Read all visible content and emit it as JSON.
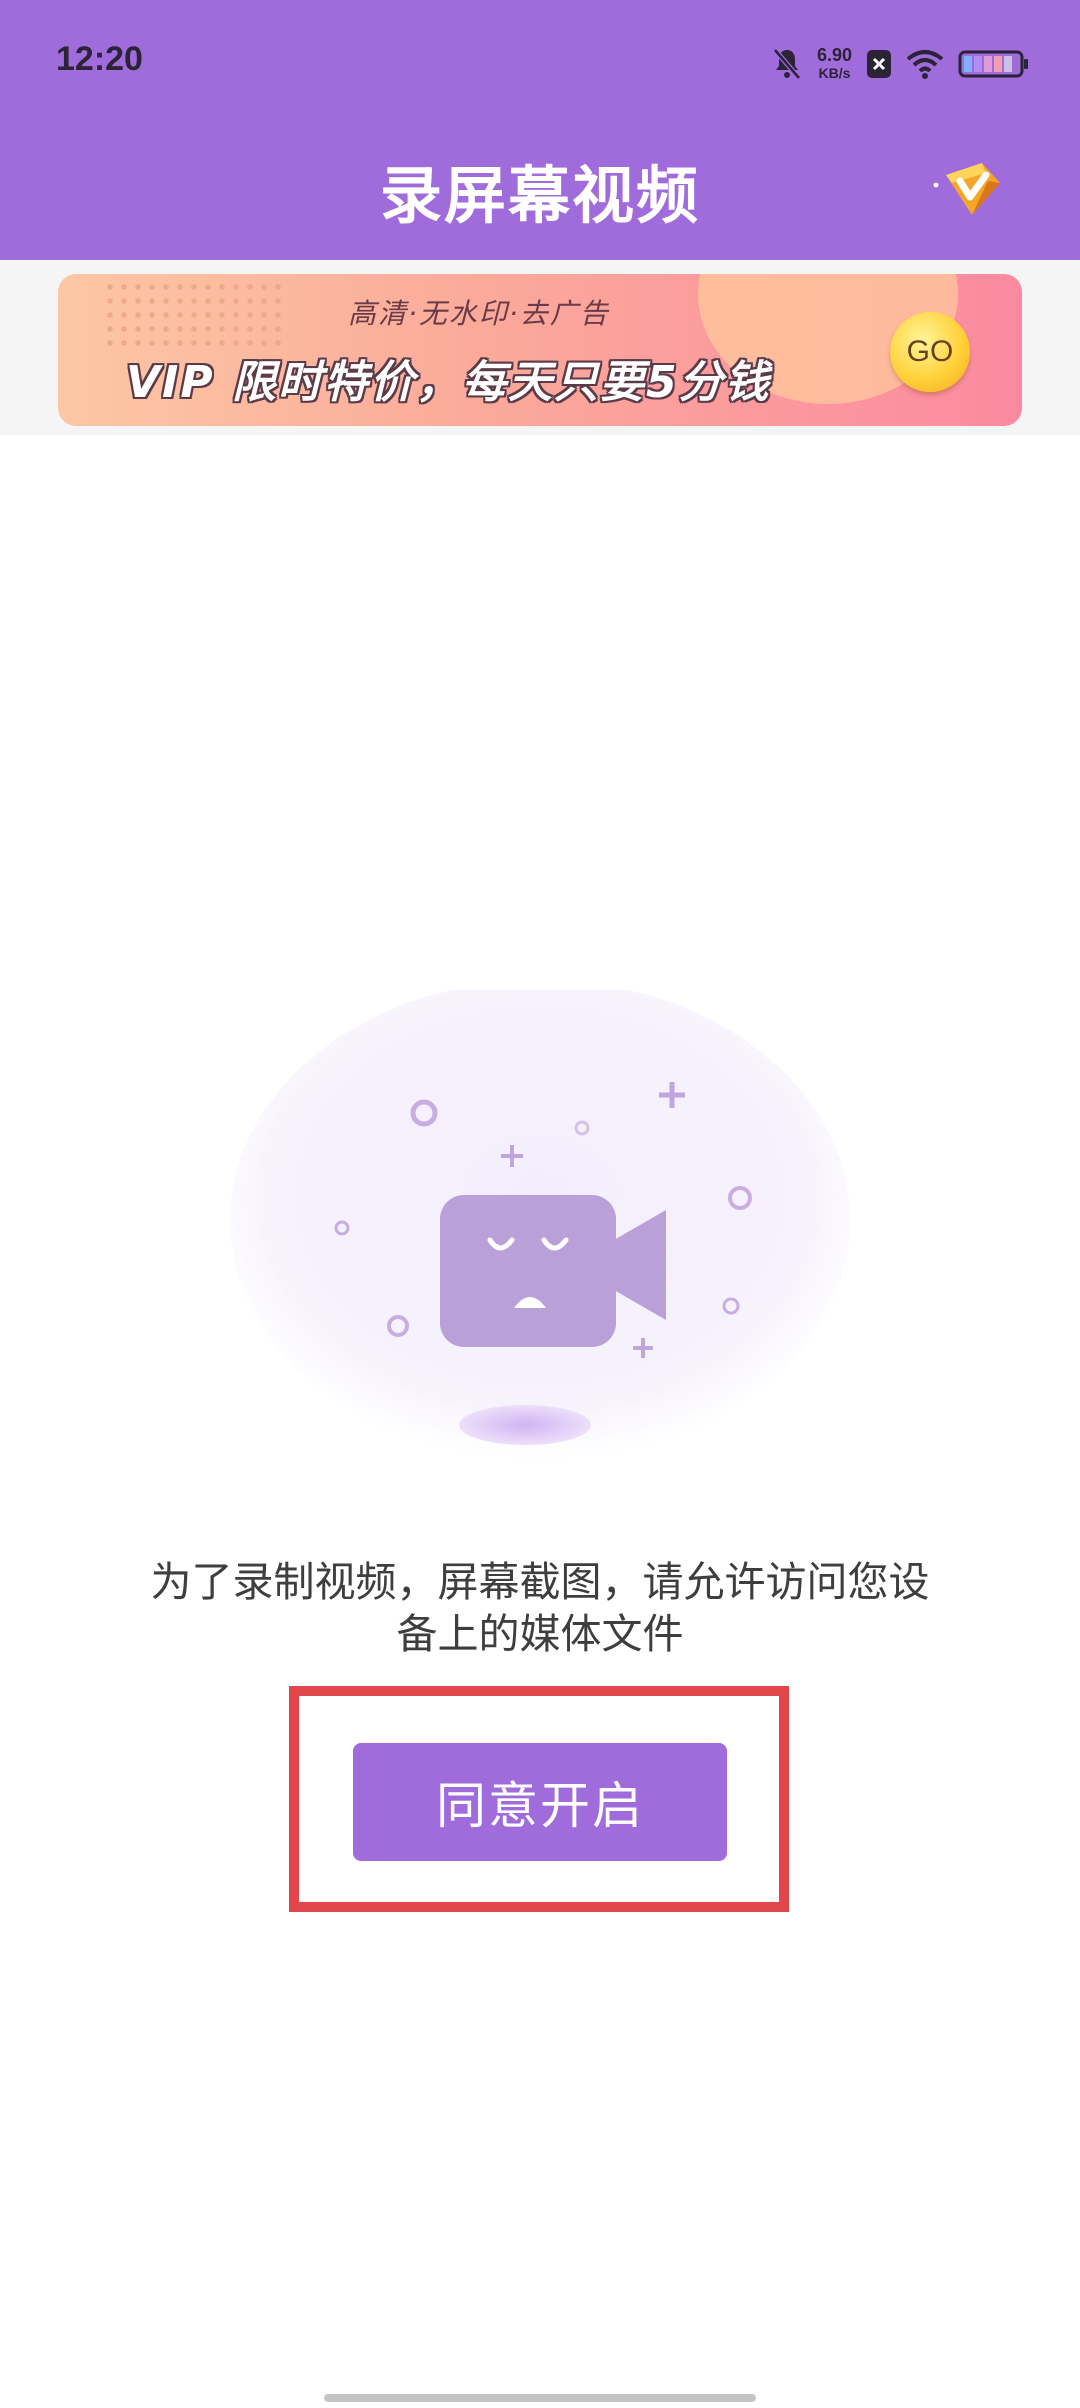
{
  "status_bar": {
    "time": "12:20",
    "net_speed_value": "6.90",
    "net_speed_unit": "KB/s",
    "icons": [
      "bell-mute-icon",
      "close-box-icon",
      "wifi-icon",
      "battery-icon"
    ]
  },
  "app_bar": {
    "title": "录屏幕视频",
    "badge_icon": "vip-diamond-icon"
  },
  "banner": {
    "subtitle": "高清·无水印·去广告",
    "headline": "VIP 限时特价，每天只要5分钱",
    "go_label": "GO"
  },
  "empty_state": {
    "illustration_icon": "sad-video-camera-icon",
    "message_line1": "为了录制视频，屏幕截图，请允许访问您设",
    "message_line2": "备上的媒体文件"
  },
  "actions": {
    "agree_label": "同意开启"
  },
  "colors": {
    "primary": "#a06cdc",
    "highlight_border": "#e0464a",
    "text": "#3e3e3e"
  }
}
